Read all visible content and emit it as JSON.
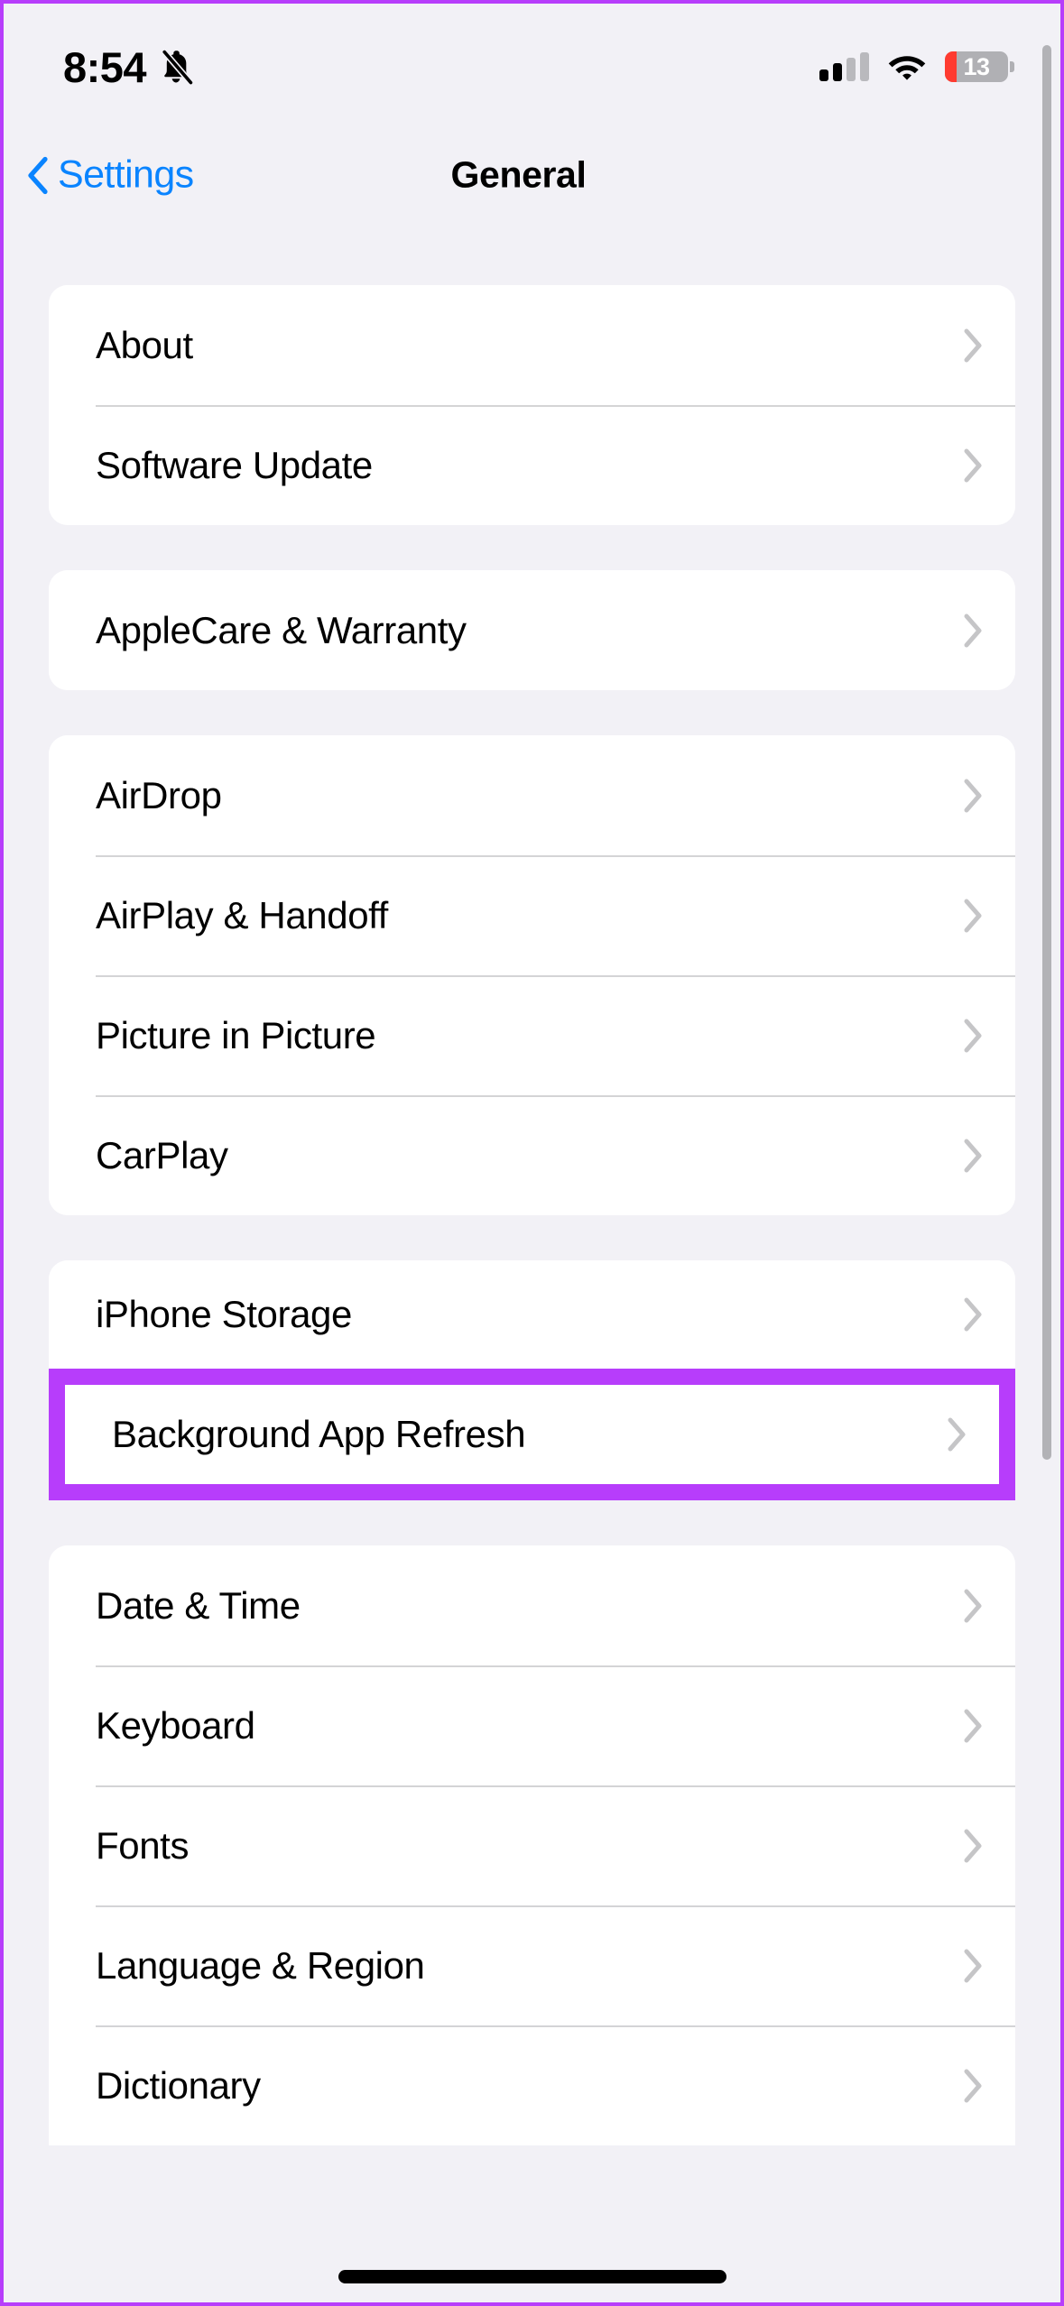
{
  "status_bar": {
    "time": "8:54",
    "silent_icon": "bell-slash-icon",
    "cellular_bars_filled": 2,
    "cellular_bars_total": 4,
    "wifi_icon": "wifi-icon",
    "battery_level": "13",
    "battery_low_color": "#ff3b30"
  },
  "nav": {
    "back_label": "Settings",
    "title": "General"
  },
  "theme": {
    "background": "#f2f1f6",
    "card": "#ffffff",
    "accent_blue": "#0a84ff",
    "chevron_gray": "#c5c5c7",
    "separator": "#d4d4d6",
    "highlight_purple": "#b73dfb",
    "scrollbar": "#b2b2b6"
  },
  "groups": [
    {
      "id": "group-info",
      "rows": [
        {
          "label": "About"
        },
        {
          "label": "Software Update"
        }
      ]
    },
    {
      "id": "group-applecare",
      "rows": [
        {
          "label": "AppleCare & Warranty"
        }
      ]
    },
    {
      "id": "group-connectivity",
      "rows": [
        {
          "label": "AirDrop"
        },
        {
          "label": "AirPlay & Handoff"
        },
        {
          "label": "Picture in Picture"
        },
        {
          "label": "CarPlay"
        }
      ]
    },
    {
      "id": "group-storage",
      "rows": [
        {
          "label": "iPhone Storage"
        }
      ]
    },
    {
      "id": "group-highlighted",
      "highlighted": true,
      "rows": [
        {
          "label": "Background App Refresh"
        }
      ]
    },
    {
      "id": "group-localization",
      "rows": [
        {
          "label": "Date & Time"
        },
        {
          "label": "Keyboard"
        },
        {
          "label": "Fonts"
        },
        {
          "label": "Language & Region"
        },
        {
          "label": "Dictionary"
        }
      ]
    }
  ]
}
